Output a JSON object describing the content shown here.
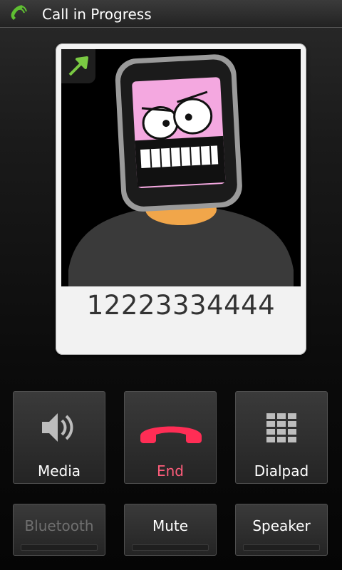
{
  "title_bar": {
    "title": "Call in Progress",
    "icon": "phone-in-call-icon",
    "icon_color": "#6dc23c"
  },
  "caller": {
    "number": "12223334444",
    "share_icon": "share-arrow-icon"
  },
  "call_controls": [
    {
      "label": "Media",
      "icon": "speaker-volume-icon",
      "enabled": true
    },
    {
      "label": "End",
      "icon": "end-call-icon",
      "label_color": "#ff5d7b",
      "icon_color": "#ff2d55"
    },
    {
      "label": "Dialpad",
      "icon": "dialpad-icon",
      "enabled": true
    }
  ],
  "toggle_controls": [
    {
      "label": "Bluetooth",
      "enabled": false,
      "on": false
    },
    {
      "label": "Mute",
      "enabled": true,
      "on": false
    },
    {
      "label": "Speaker",
      "enabled": true,
      "on": false
    }
  ]
}
